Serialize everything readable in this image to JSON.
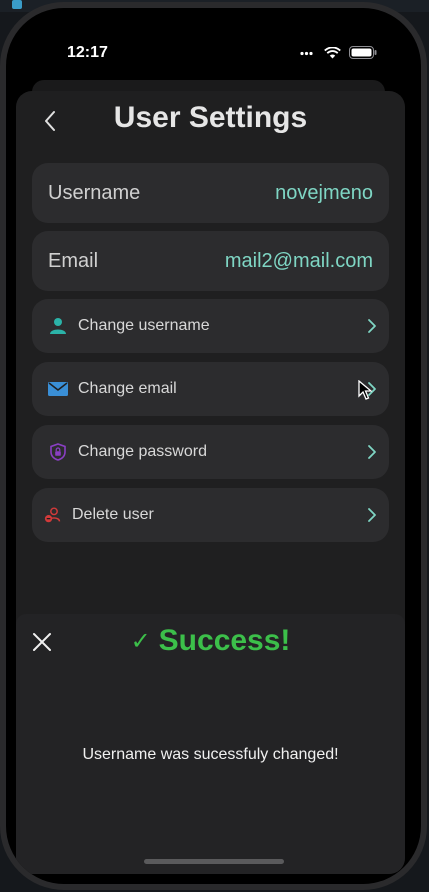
{
  "status_bar": {
    "time": "12:17"
  },
  "header": {
    "title": "User Settings"
  },
  "info": {
    "username_label": "Username",
    "username_value": "novejmeno",
    "email_label": "Email",
    "email_value": "mail2@mail.com"
  },
  "actions": [
    {
      "label": "Change username",
      "icon": "person-icon",
      "color": "#2bb3a8"
    },
    {
      "label": "Change email",
      "icon": "envelope-icon",
      "color": "#3a8fd6"
    },
    {
      "label": "Change password",
      "icon": "shield-lock-icon",
      "color": "#8a3fc4"
    },
    {
      "label": "Delete user",
      "icon": "delete-user-icon",
      "color": "#d33a3a"
    }
  ],
  "toast": {
    "title": "Success!",
    "check": "✓",
    "message": "Username was sucessfuly changed!",
    "color": "#3cbf4a"
  },
  "colors": {
    "accent_value": "#7fd6c4",
    "chevron": "#7fd6c4"
  }
}
